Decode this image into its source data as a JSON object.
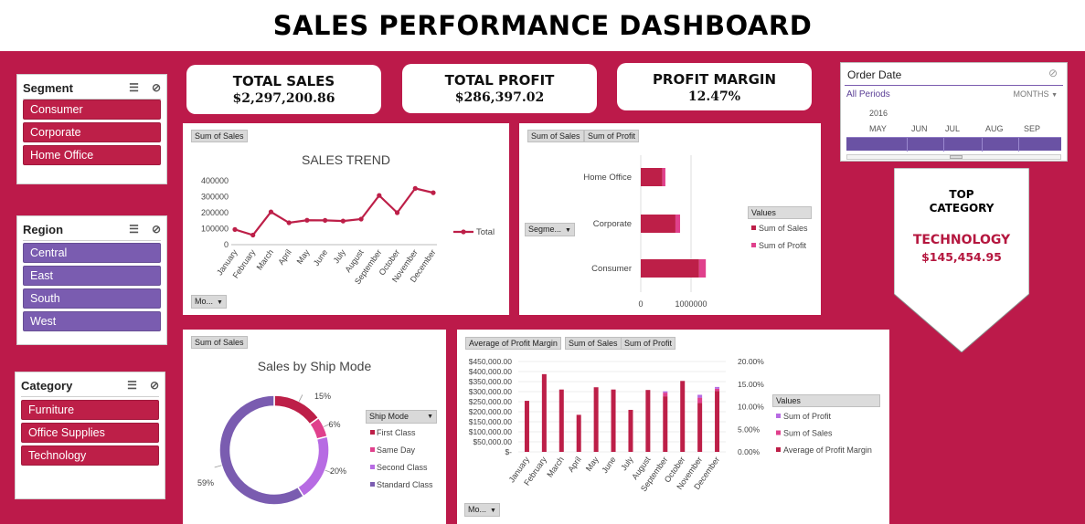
{
  "title": "SALES PERFORMANCE DASHBOARD",
  "slicers": {
    "segment": {
      "title": "Segment",
      "items": [
        "Consumer",
        "Corporate",
        "Home Office"
      ]
    },
    "region": {
      "title": "Region",
      "items": [
        "Central",
        "East",
        "South",
        "West"
      ]
    },
    "category": {
      "title": "Category",
      "items": [
        "Furniture",
        "Office Supplies",
        "Technology"
      ]
    }
  },
  "kpis": {
    "total_sales": {
      "label": "TOTAL SALES",
      "value": "$2,297,200.86"
    },
    "total_profit": {
      "label": "TOTAL PROFIT",
      "value": "$286,397.02"
    },
    "profit_margin": {
      "label": "PROFIT MARGIN",
      "value": "12.47%"
    }
  },
  "timeline": {
    "title": "Order Date",
    "periods_label": "All Periods",
    "unit": "MONTHS",
    "year": "2016",
    "months": [
      "MAY",
      "JUN",
      "JUL",
      "AUG",
      "SEP"
    ]
  },
  "top_category": {
    "label_line1": "TOP",
    "label_line2": "CATEGORY",
    "name": "TECHNOLOGY",
    "value": "$145,454.95"
  },
  "colors": {
    "background": "#bc1a4a",
    "crimson": "#bd1f48",
    "purple": "#7a5cb0",
    "pink": "#e0408c",
    "violet": "#b76be3"
  },
  "sales_trend_panel": {
    "field_button": "Sum of Sales",
    "filter_button": "Mo..."
  },
  "segment_panel": {
    "field_buttons": [
      "Sum of Sales",
      "Sum of Profit"
    ],
    "axis_filter": "Segme...",
    "legend_title": "Values"
  },
  "ship_panel": {
    "field_button": "Sum of Sales",
    "legend_title": "Ship Mode"
  },
  "margin_panel": {
    "field_buttons": [
      "Average of Profit Margin",
      "Sum of Sales",
      "Sum of Profit"
    ],
    "filter_button": "Mo...",
    "legend_title": "Values"
  },
  "chart_data": [
    {
      "id": "sales_trend",
      "type": "line",
      "title": "SALES TREND",
      "categories": [
        "January",
        "February",
        "March",
        "April",
        "May",
        "June",
        "July",
        "August",
        "September",
        "October",
        "November",
        "December"
      ],
      "series": [
        {
          "name": "Total",
          "values": [
            95000,
            60000,
            205000,
            137000,
            153000,
            152000,
            148000,
            160000,
            308000,
            200000,
            352000,
            325000
          ]
        }
      ],
      "yticks": [
        "400000",
        "300000",
        "200000",
        "100000",
        "0"
      ],
      "ylim": [
        0,
        400000
      ],
      "legend": "right"
    },
    {
      "id": "segment_bars",
      "type": "bar",
      "categories": [
        "Home Office",
        "Corporate",
        "Consumer"
      ],
      "series": [
        {
          "name": "Sum of Sales",
          "values": [
            430000,
            690000,
            1160000
          ]
        },
        {
          "name": "Sum of Profit",
          "values": [
            60000,
            92000,
            134000
          ]
        }
      ],
      "xticks": [
        "0",
        "1000000"
      ],
      "xlim": [
        0,
        1000000
      ],
      "legend": "right"
    },
    {
      "id": "ship_mode",
      "type": "pie",
      "title": "Sales by Ship Mode",
      "categories": [
        "First Class",
        "Same Day",
        "Second Class",
        "Standard Class"
      ],
      "values": [
        15,
        6,
        20,
        59
      ],
      "labels": [
        "15%",
        "6%",
        "20%",
        "59%"
      ],
      "legend": "right"
    },
    {
      "id": "profit_margin_combo",
      "type": "bar",
      "categories": [
        "January",
        "February",
        "March",
        "April",
        "May",
        "June",
        "July",
        "August",
        "September",
        "October",
        "November",
        "December"
      ],
      "series": [
        {
          "name": "Sum of Profit",
          "values": [
            0,
            0,
            0,
            0,
            0,
            0,
            0,
            0,
            45000,
            0,
            95000,
            60000
          ]
        },
        {
          "name": "Sum of Sales",
          "values": [
            0,
            0,
            0,
            0,
            0,
            0,
            0,
            0,
            120000,
            0,
            180000,
            70000
          ]
        },
        {
          "name": "Average of Profit Margin",
          "values": [
            0.113,
            0.172,
            0.138,
            0.082,
            0.143,
            0.138,
            0.093,
            0.137,
            0.123,
            0.157,
            0.108,
            0.135
          ]
        }
      ],
      "yticks": [
        "$450,000.00",
        "$400,000.00",
        "$350,000.00",
        "$300,000.00",
        "$250,000.00",
        "$200,000.00",
        "$150,000.00",
        "$100,000.00",
        "$50,000.00",
        "$-"
      ],
      "ylim": [
        0,
        450000
      ],
      "y2ticks": [
        "20.00%",
        "15.00%",
        "10.00%",
        "5.00%",
        "0.00%"
      ],
      "y2lim": [
        0,
        0.2
      ],
      "legend": "right"
    }
  ]
}
